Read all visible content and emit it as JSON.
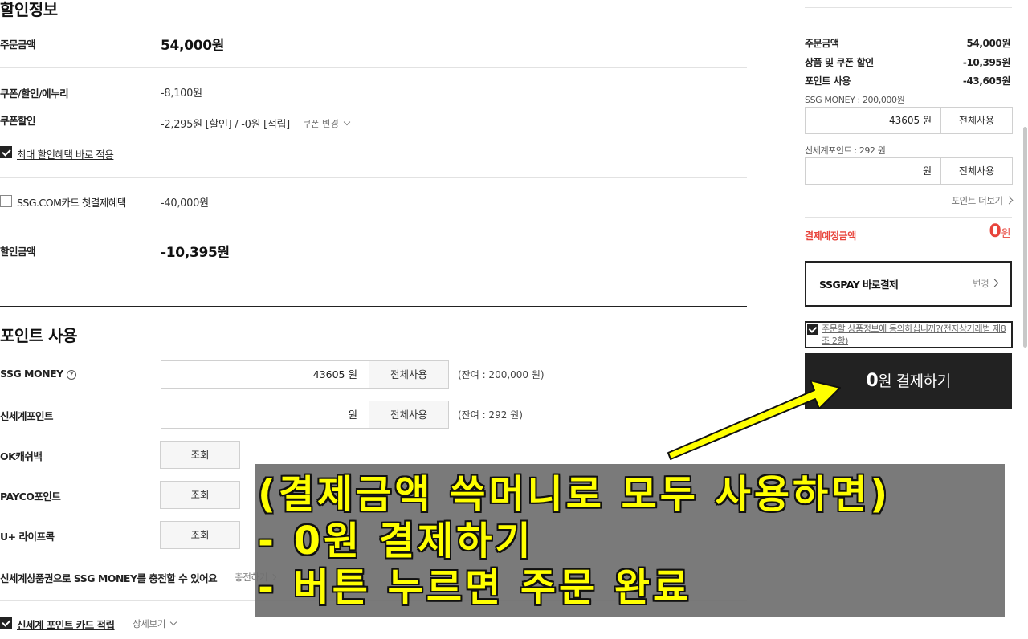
{
  "discount": {
    "title": "할인정보",
    "order_amount_label": "주문금액",
    "order_amount_value": "54,000원",
    "coupon_label": "쿠폰/할인/에누리",
    "coupon_value": "-8,100원",
    "coupon_discount_label": "쿠폰할인",
    "coupon_discount_value": "-2,295원 [할인] / -0원 [적립]",
    "coupon_change_label": "쿠폰 변경",
    "max_benefit_label": "최대 할인혜택 바로 적용",
    "ssgcard_label": "SSG.COM카드 첫결제혜택",
    "ssgcard_value": "-40,000원",
    "discount_total_label": "할인금액",
    "discount_total_value": "-10,395원"
  },
  "points": {
    "title": "포인트 사용",
    "ssg_money_label": "SSG MONEY",
    "ssg_money_value": "43605 원",
    "use_all_label": "전체사용",
    "ssg_money_balance": "(잔여 : 200,000 원)",
    "shinsegae_label": "신세계포인트",
    "shinsegae_value": "원",
    "shinsegae_balance": "(잔여 : 292 원)",
    "ok_label": "OK캐쉬백",
    "payco_label": "PAYCO포인트",
    "uplus_label": "U+ 라이프콕",
    "inquire_label": "조회",
    "gift_label": "신세계상품권으로 SSG MONEY를 충전할 수 있어요",
    "charge_label": "충전하기",
    "card_accrue_label": "신세계 포인트 카드 적립",
    "detail_label": "상세보기"
  },
  "summary": {
    "order_amount_label": "주문금액",
    "order_amount_value": "54,000원",
    "product_coupon_label": "상품 및 쿠폰 할인",
    "product_coupon_value": "-10,395원",
    "point_use_label": "포인트 사용",
    "point_use_value": "-43,605원",
    "ssg_money_caption": "SSG MONEY : 200,000원",
    "ssg_money_input": "43605 원",
    "use_all_label": "전체사용",
    "shinsegae_caption": "신세계포인트 : 292 원",
    "shinsegae_input": "원",
    "more_points_label": "포인트 더보기",
    "expected_label": "결제예정금액",
    "expected_num": "0",
    "expected_unit": "원",
    "pay_method_label": "SSGPAY 바로결제",
    "pay_method_change": "변경",
    "agree_text": "주문할 상품정보에 동의하십니까?(전자상거래법 제8조 2항)",
    "pay_button_num": "0",
    "pay_button_text": "원 결제하기"
  },
  "annotation": {
    "line1": "(결제금액 쓱머니로 모두 사용하면)",
    "line2": "- 0원 결제하기",
    "line3": "- 버튼 누르면 주문 완료",
    "text_color": "#ffff00",
    "arrow_color": "#ffff00"
  },
  "colors": {
    "accent_red": "#e8453c",
    "dark": "#222222"
  }
}
